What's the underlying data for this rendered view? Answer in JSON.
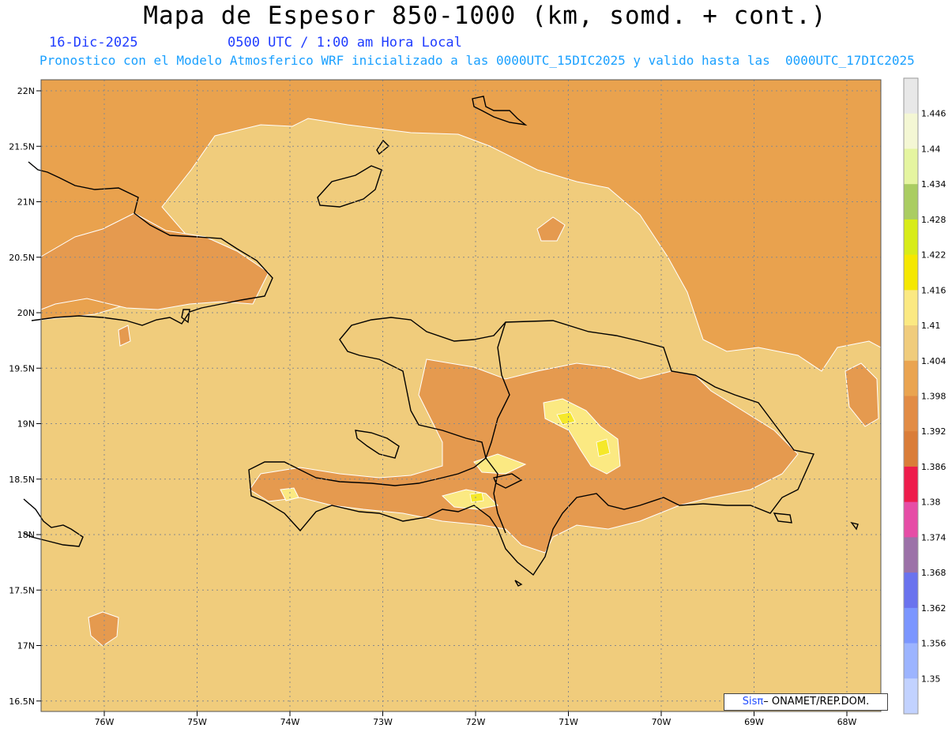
{
  "title": "Mapa de Espesor 850-1000 (km, somd. + cont.)",
  "date_label": "16-Dic-2025",
  "time_label": "0500 UTC / 1:00 am Hora Local",
  "model_info": "Pronostico con el Modelo Atmosferico WRF inicializado a las 0000UTC_15DIC2025 y valido hasta las  0000UTC_17DIC2025",
  "credit": {
    "brand": "Sisπ",
    "text": "– ONAMET/REP.DOM."
  },
  "map": {
    "lat_labels": [
      "22N",
      "21.5N",
      "21N",
      "20.5N",
      "20N",
      "19.5N",
      "19N",
      "18.5N",
      "18N",
      "17.5N",
      "17N",
      "16.5N"
    ],
    "lon_labels": [
      "76W",
      "75W",
      "74W",
      "73W",
      "72W",
      "71W",
      "70W",
      "69W",
      "68W"
    ],
    "lat_values": [
      22,
      21.5,
      21,
      20.5,
      20,
      19.5,
      19,
      18.5,
      18,
      17.5,
      17,
      16.5
    ],
    "lon_values": [
      -76,
      -75,
      -74,
      -73,
      -72,
      -71,
      -70,
      -69,
      -68
    ],
    "fill_colors": {
      "background": "#e9a24e",
      "dominant": "#f0cc7c",
      "interior": "#e59a4f",
      "highlight_1": "#fbe982",
      "highlight_2": "#f5e82a",
      "coastline": "#000000"
    }
  },
  "colorbar": {
    "labels": [
      "1.446",
      "1.44",
      "1.434",
      "1.428",
      "1.422",
      "1.416",
      "1.41",
      "1.404",
      "1.398",
      "1.392",
      "1.386",
      "1.38",
      "1.374",
      "1.368",
      "1.362",
      "1.356",
      "1.35"
    ],
    "colors": [
      "#e8e8e8",
      "#f4f7d4",
      "#e5f5a0",
      "#aacd62",
      "#d8ec18",
      "#f5e800",
      "#fbe982",
      "#f0cc7c",
      "#eaa450",
      "#e28c45",
      "#da7d39",
      "#ee1c4c",
      "#e64da6",
      "#9c72a8",
      "#6a73ee",
      "#7b96ff",
      "#9cb4ff",
      "#c2d2ff"
    ]
  }
}
